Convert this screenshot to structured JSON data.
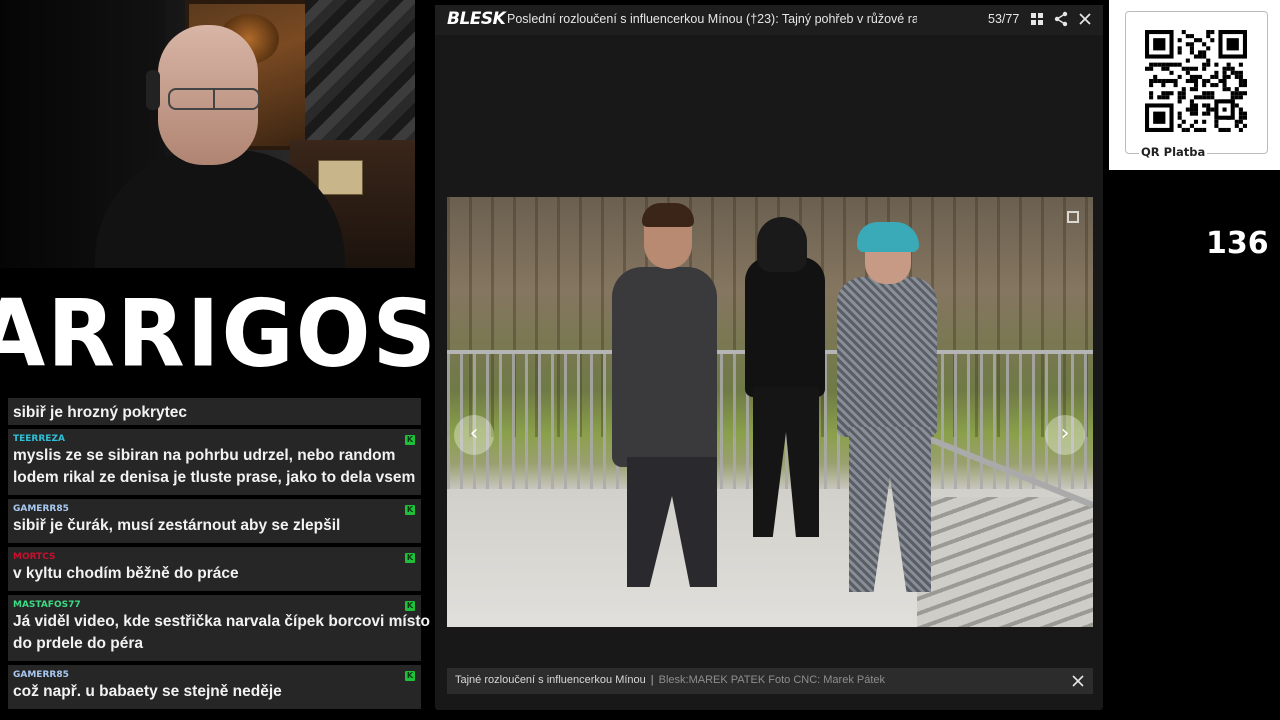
{
  "stream": {
    "logo_text": "ARRIGOS",
    "viewer_count": "136"
  },
  "chat": {
    "messages": [
      {
        "user": "",
        "text_lines": [
          "sibiř je hrozný pokrytec"
        ],
        "user_color": "#2fc0d8"
      },
      {
        "user": "TEERREZA",
        "text_lines": [
          "myslis ze se sibiran na pohrbu udrzel, nebo random",
          "lodem rikal ze denisa je tluste prase, jako to dela vsem"
        ],
        "user_color": "#2fc0d8"
      },
      {
        "user": "GAMERR85",
        "text_lines": [
          "sibiř je čurák, musí zestárnout aby se zlepšil"
        ],
        "user_color": "#a9c9f0"
      },
      {
        "user": "MORTCS",
        "text_lines": [
          "v kyltu chodím běžně do práce"
        ],
        "user_color": "#c8102e"
      },
      {
        "user": "MASTAFOS77",
        "text_lines": [
          "Já viděl video, kde sestřička narvala čípek borcovi místo",
          "do prdele do péra"
        ],
        "user_color": "#3ddc84"
      },
      {
        "user": "GAMERR85",
        "text_lines": [
          "což např. u babaety se stejně neděje"
        ],
        "user_color": "#a9c9f0"
      }
    ],
    "badge_glyph": "K",
    "badge_color": "#1fbf3a"
  },
  "gallery": {
    "brand": "BLESK",
    "title": "Poslední rozloučení s influencerkou Mínou (†23): Tajný pohřeb v růžové ra...",
    "counter": "53/77",
    "caption": "Tajné rozloučení s influencerkou Mínou",
    "caption_separator": "|",
    "credit": "Blesk:MAREK PATEK Foto CNC: Marek Pátek",
    "prev_glyph": "‹",
    "next_glyph": "›",
    "icons": [
      "grid-icon",
      "share-icon",
      "close-icon",
      "expand-icon"
    ]
  },
  "qr": {
    "label": "QR Platba"
  }
}
